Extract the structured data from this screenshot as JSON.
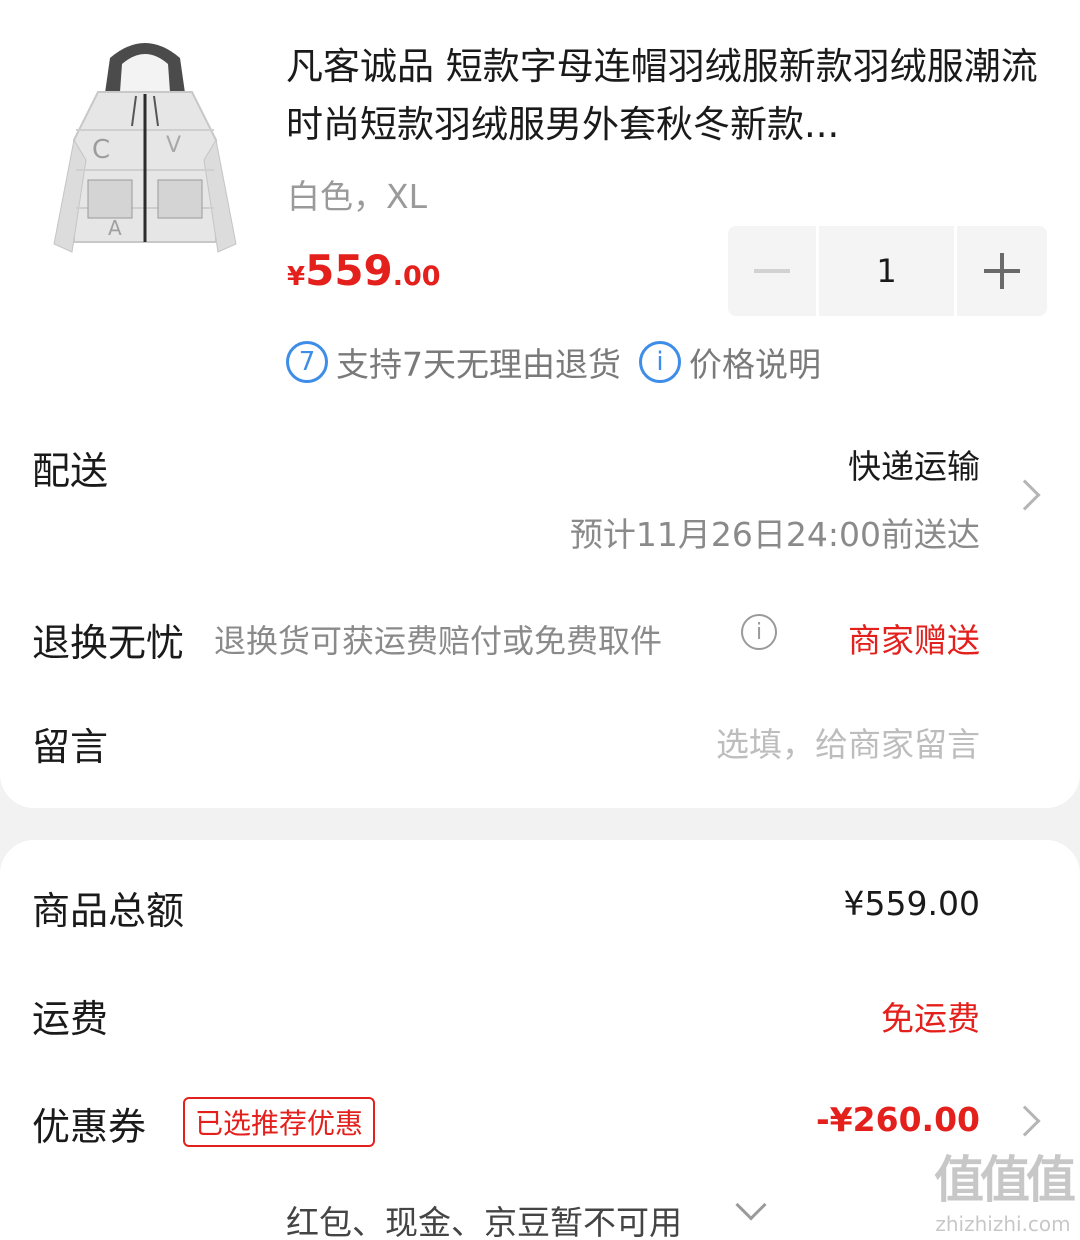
{
  "product": {
    "title": "凡客诚品 短款字母连帽羽绒服新款羽绒服潮流时尚短款羽绒服男外套秋冬新款...",
    "spec": "白色，XL",
    "price_currency": "¥",
    "price_integer": "559",
    "price_decimal": ".00",
    "quantity": "1",
    "promise_badge": "7",
    "promise_return": "支持7天无理由退货",
    "info_badge": "i",
    "promise_price_note": "价格说明"
  },
  "delivery": {
    "label": "配送",
    "method": "快递运输",
    "eta": "预计11月26日24:00前送达"
  },
  "returns": {
    "label": "退换无忧",
    "desc": "退换货可获运费赔付或免费取件",
    "value": "商家赠送"
  },
  "message": {
    "label": "留言",
    "placeholder": "选填，给商家留言"
  },
  "summary": {
    "goods_total_label": "商品总额",
    "goods_total": "¥559.00",
    "shipping_label": "运费",
    "shipping_value": "免运费",
    "coupon_label": "优惠券",
    "coupon_tag": "已选推荐优惠",
    "coupon_value": "-¥260.00",
    "more_payment": "红包、现金、京豆暂不可用"
  },
  "watermark": {
    "big": "值值值",
    "small": "zhizhizhi.com"
  },
  "colors": {
    "accent_red": "#e4201c",
    "promise_blue": "#3e8de8"
  }
}
